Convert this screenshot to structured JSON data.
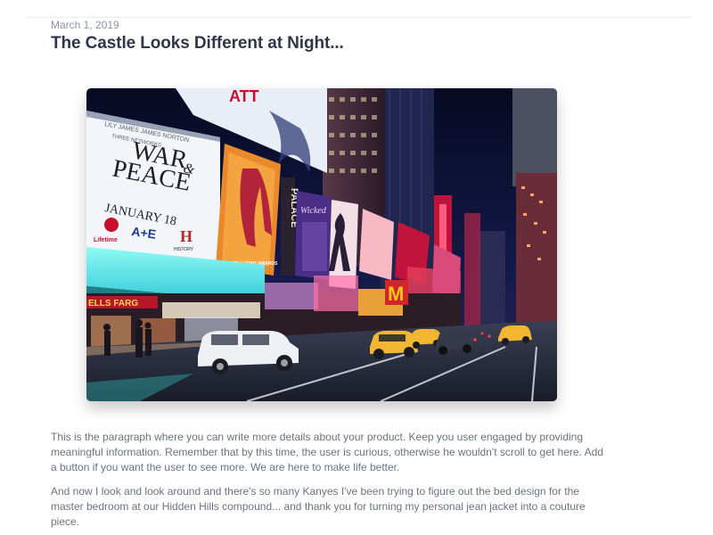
{
  "post": {
    "date": "March 1, 2019",
    "title": "The Castle Looks Different at Night...",
    "paragraphs": [
      "This is the paragraph where you can write more details about your product. Keep you user engaged by providing meaningful information. Remember that by this time, the user is curious, otherwise he wouldn't scroll to get here. Add a button if you want the user to see more. We are here to make life better.",
      "And now I look and look around and there's so many Kanyes I've been trying to figure out the bed design for the master bedroom at our Hidden Hills compound... and thank you for turning my personal jean jacket into a couture piece."
    ]
  },
  "image": {
    "billboards": {
      "war_peace_top": "LILY JAMES  JAMES NORTON",
      "war_peace_small": "THREE NETWORKS",
      "war_peace_title1": "WAR",
      "war_peace_amp": "&",
      "war_peace_title2": "PEACE",
      "war_peace_date": "JANUARY 18",
      "net1": "Lifetime",
      "net2": "A+E",
      "net3": "H",
      "net3_sub": "HISTORY",
      "kinky_small": "WINNER! 6 TONY AWARDS",
      "palace": "PALACE",
      "wicked": "Wicked",
      "store": "ELLS FARG",
      "mcd": "M"
    },
    "colors": {
      "sky": "#0b1030",
      "neon_cyan": "#5ef0ea",
      "taxi": "#f2b632"
    }
  }
}
